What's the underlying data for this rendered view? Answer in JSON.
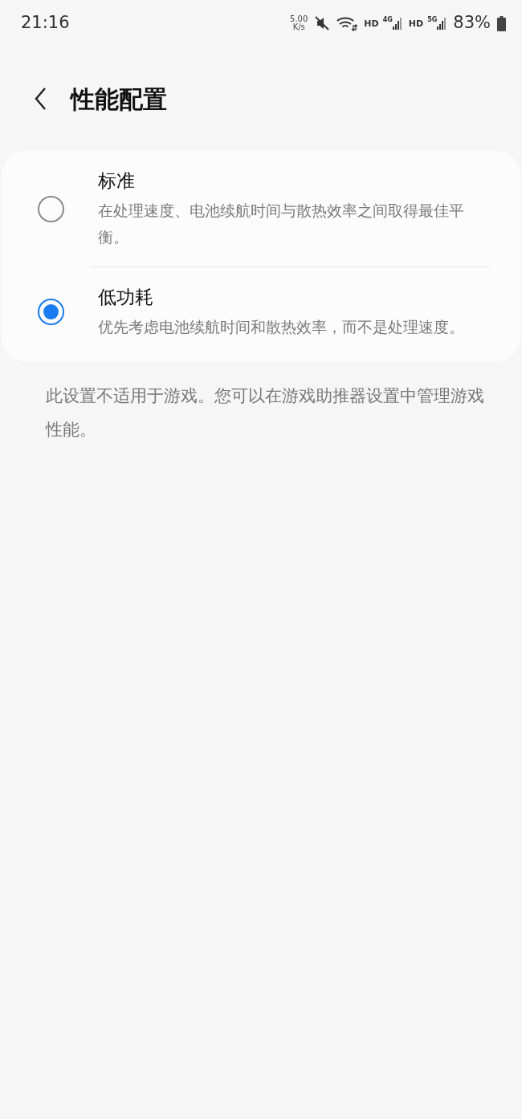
{
  "status_bar": {
    "time": "21:16",
    "speed_value": "5.00",
    "speed_unit": "K/s",
    "muted": true,
    "network_1": {
      "hd": "HD",
      "type": "4G"
    },
    "network_2": {
      "hd": "HD",
      "type": "5G"
    },
    "battery": "83%"
  },
  "header": {
    "title": "性能配置"
  },
  "options": [
    {
      "title": "标准",
      "description": "在处理速度、电池续航时间与散热效率之间取得最佳平衡。",
      "selected": false
    },
    {
      "title": "低功耗",
      "description": "优先考虑电池续航时间和散热效率，而不是处理速度。",
      "selected": true
    }
  ],
  "note": "此设置不适用于游戏。您可以在游戏助推器设置中管理游戏性能。"
}
